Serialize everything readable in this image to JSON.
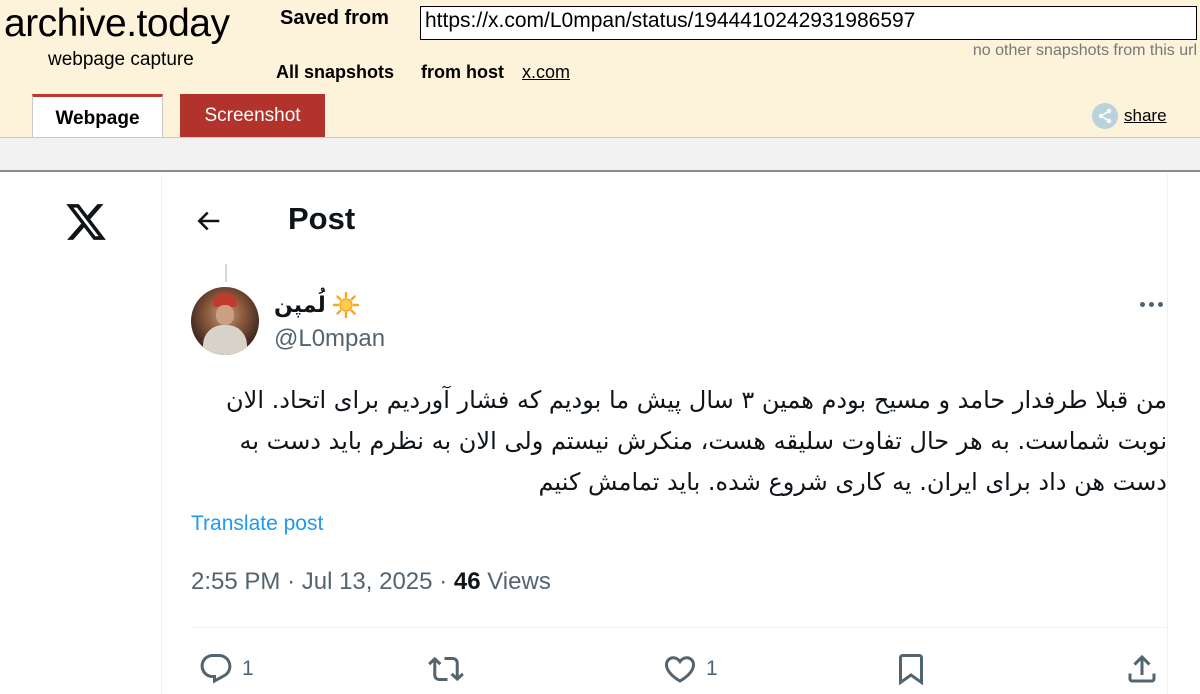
{
  "archive": {
    "logo": "archive.today",
    "logo_sub": "webpage capture",
    "saved_from_label": "Saved from",
    "url": "https://x.com/L0mpan/status/1944410242931986597",
    "no_other": "no other snapshots from this url",
    "all_snapshots": "All snapshots",
    "from_host": "from host",
    "host": "x.com",
    "tab_webpage": "Webpage",
    "tab_screenshot": "Screenshot",
    "share": "share",
    "accent_color": "#b2332b"
  },
  "page": {
    "header_title": "Post",
    "author": {
      "display_name": "لُمپن",
      "emoji": "sun-icon",
      "handle": "@L0mpan"
    },
    "tweet_text": "من قبلا طرفدار حامد و مسیح بودم همین ۳ سال پیش ما بودیم که فشار آوردیم برای اتحاد. الان نوبت شماست. به هر حال تفاوت سلیقه هست، منکرش نیستم ولی الان به نظرم باید دست به دست هن داد برای ایران. یه کاری شروع شده. باید تمامش کنیم",
    "translate": "Translate post",
    "time": "2:55 PM",
    "sep1": "·",
    "date": "Jul 13, 2025",
    "sep2": "·",
    "views_count": "46",
    "views_label": "Views",
    "actions": {
      "reply_count": "1",
      "retweet_count": "",
      "like_count": "1"
    },
    "link_color": "#1d9bf0"
  }
}
